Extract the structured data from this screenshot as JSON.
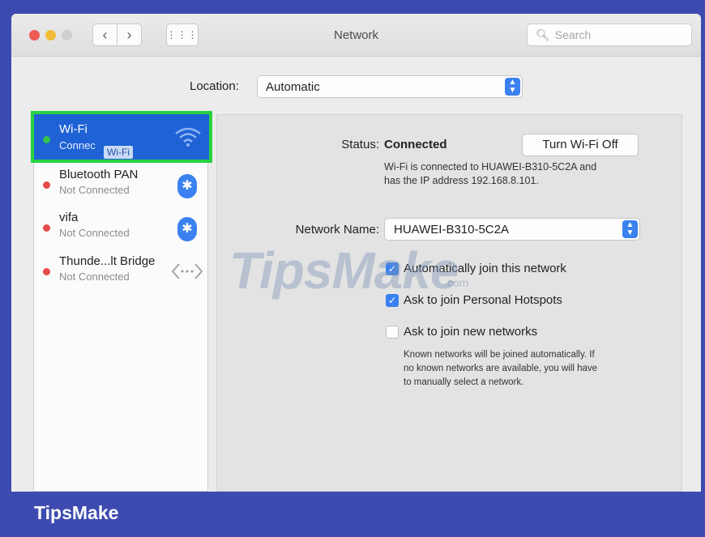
{
  "window": {
    "title": "Network"
  },
  "toolbar": {
    "back_label": "‹",
    "forward_label": "›",
    "grid_label": "⋮⋮⋮",
    "search_placeholder": "Search",
    "search_icon": "magnifier-icon"
  },
  "location": {
    "label": "Location:",
    "value": "Automatic"
  },
  "services": [
    {
      "name": "Wi-Fi",
      "status": "Connec",
      "tooltip": "Wi-Fi",
      "state_color": "#35c24a",
      "icon": "wifi-icon",
      "selected": true
    },
    {
      "name": "Bluetooth PAN",
      "status": "Not Connected",
      "state_color": "#e64a4a",
      "icon": "bluetooth-icon"
    },
    {
      "name": "vifa",
      "status": "Not Connected",
      "state_color": "#e64a4a",
      "icon": "bluetooth-icon"
    },
    {
      "name": "Thunde...lt Bridge",
      "status": "Not Connected",
      "state_color": "#e64a4a",
      "icon": "thunderbolt-bridge-icon"
    }
  ],
  "detail": {
    "status_label": "Status:",
    "status_value": "Connected",
    "turn_off_label": "Turn Wi-Fi Off",
    "status_desc_1": "Wi-Fi is connected to HUAWEI-B310-5C2A and",
    "status_desc_2": "has the IP address 192.168.8.101.",
    "network_name_label": "Network Name:",
    "network_name_value": "HUAWEI-B310-5C2A",
    "options": [
      {
        "label": "Automatically join this network",
        "checked": true
      },
      {
        "label": "Ask to join Personal Hotspots",
        "checked": true
      },
      {
        "label": "Ask to join new networks",
        "checked": false
      }
    ],
    "note_1": "Known networks will be joined automatically. If",
    "note_2": "no known networks are available, you will have",
    "note_3": "to manually select a network."
  },
  "watermark": {
    "text": "TipsMake",
    "suffix": ".com"
  },
  "brand": {
    "text": "TipsMake"
  },
  "colors": {
    "accent": "#3b82f0",
    "selection": "#1f62d6",
    "highlight_border": "#28d23f",
    "frame": "#3d4bb0"
  }
}
